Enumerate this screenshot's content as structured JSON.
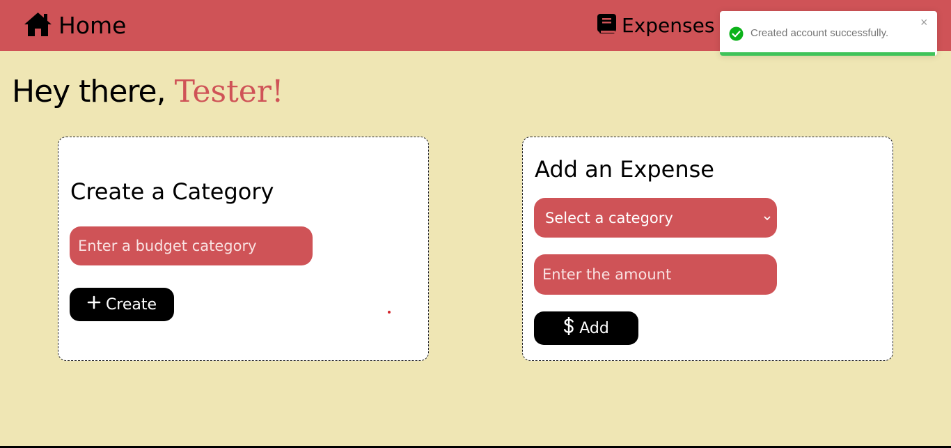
{
  "nav": {
    "home_label": "Home",
    "home_icon": "home-icon",
    "expenses_label": "Expenses",
    "expenses_icon": "book-icon"
  },
  "toast": {
    "message": "Created account successfully.",
    "close_symbol": "×",
    "icon": "check-circle-icon",
    "progress": 0.99
  },
  "greeting": {
    "prefix": "Hey there, ",
    "name": "Tester!"
  },
  "category_card": {
    "title": "Create a Category",
    "input_placeholder": "Enter a budget category",
    "button_label": "Create",
    "button_icon": "plus-icon"
  },
  "expense_card": {
    "title": "Add an Expense",
    "select_value": "Select a category",
    "amount_placeholder": "Enter the amount",
    "button_label": "Add",
    "button_icon": "dollar-icon"
  },
  "colors": {
    "accent": "#cf5357",
    "background": "#efe6b4",
    "success": "#3fc35a"
  }
}
